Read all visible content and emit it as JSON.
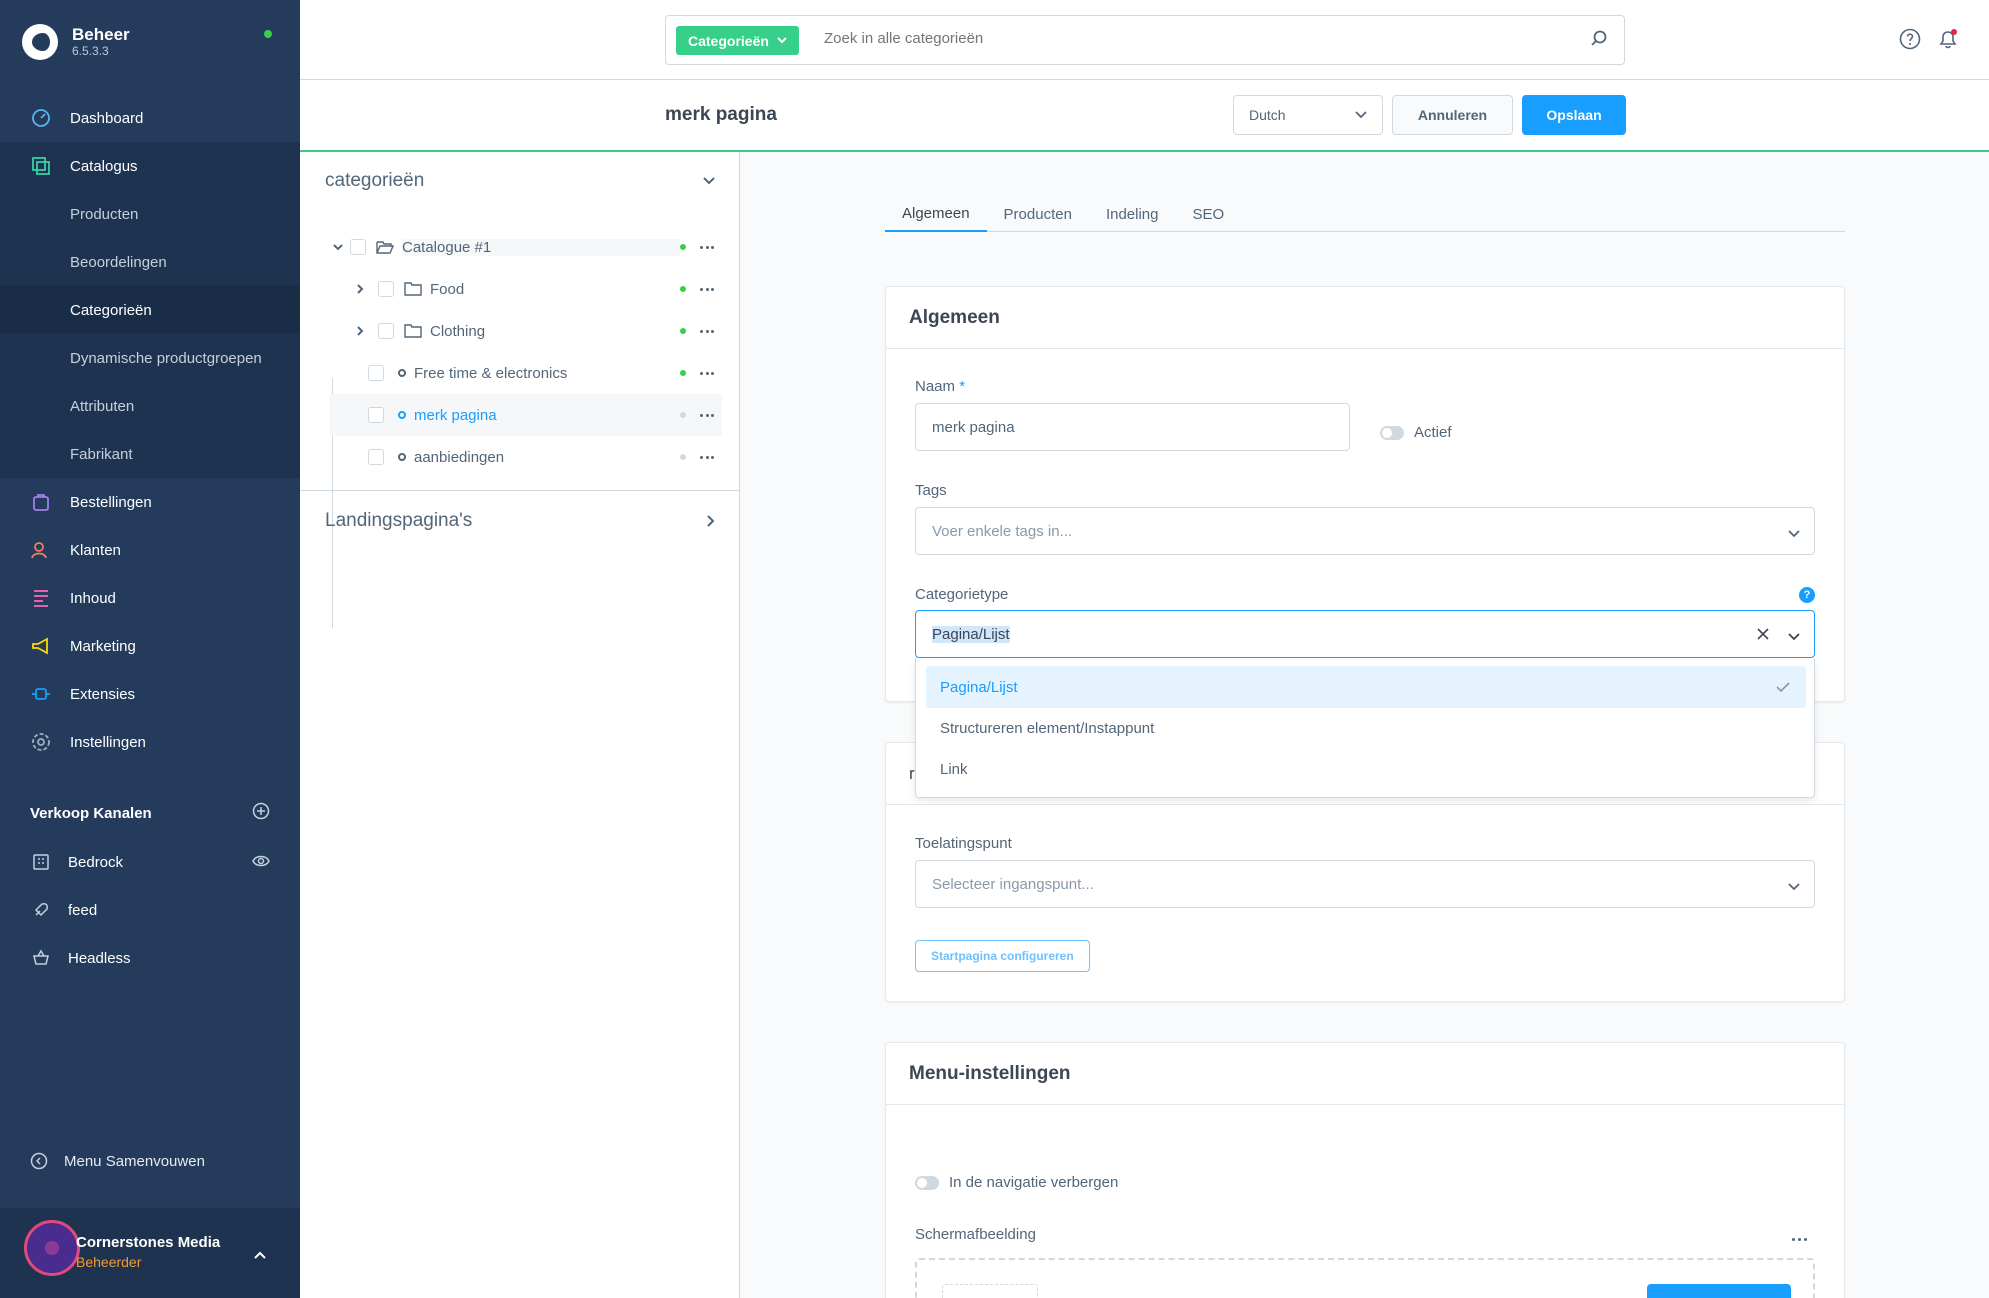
{
  "app": {
    "name": "Beheer",
    "version": "6.5.3.3"
  },
  "sidebar": {
    "items": [
      {
        "label": "Dashboard",
        "icon": "dashboard-icon"
      },
      {
        "label": "Catalogus",
        "icon": "catalog-icon"
      },
      {
        "label": "Bestellingen",
        "icon": "orders-icon"
      },
      {
        "label": "Klanten",
        "icon": "customers-icon"
      },
      {
        "label": "Inhoud",
        "icon": "content-icon"
      },
      {
        "label": "Marketing",
        "icon": "marketing-icon"
      },
      {
        "label": "Extensies",
        "icon": "extensions-icon"
      },
      {
        "label": "Instellingen",
        "icon": "settings-icon"
      }
    ],
    "catalog_sub": [
      "Producten",
      "Beoordelingen",
      "Categorieën",
      "Dynamische productgroepen",
      "Attributen",
      "Fabrikant"
    ],
    "sales_channels_title": "Verkoop Kanalen",
    "sales_channels": [
      "Bedrock",
      "feed",
      "Headless"
    ],
    "collapse_label": "Menu Samenvouwen",
    "user": {
      "name": "Cornerstones Media",
      "role": "Beheerder"
    }
  },
  "search": {
    "type": "Categorieën",
    "placeholder": "Zoek in alle categorieën"
  },
  "actionbar": {
    "title": "merk pagina",
    "language": "Dutch",
    "cancel": "Annuleren",
    "save": "Opslaan"
  },
  "tree": {
    "title": "categorieën",
    "rows": [
      {
        "label": "Catalogue #1",
        "status": "active"
      },
      {
        "label": "Food",
        "status": "active"
      },
      {
        "label": "Clothing",
        "status": "active"
      },
      {
        "label": "Free time & electronics",
        "status": "active"
      },
      {
        "label": "merk pagina",
        "status": "inactive"
      },
      {
        "label": "aanbiedingen",
        "status": "inactive"
      }
    ],
    "landing": "Landingspagina's"
  },
  "tabs": [
    "Algemeen",
    "Producten",
    "Indeling",
    "SEO"
  ],
  "general": {
    "title": "Algemeen",
    "name_label": "Naam",
    "required_mark": "*",
    "name_value": "merk pagina",
    "active_label": "Actief",
    "tags_label": "Tags",
    "tags_placeholder": "Voer enkele tags in...",
    "type_label": "Categorietype",
    "type_value": "Pagina/Lijst",
    "options": [
      "Pagina/Lijst",
      "Structureren element/Instappunt",
      "Link"
    ]
  },
  "entry": {
    "partial_title": "r",
    "label": "Toelatingspunt",
    "placeholder": "Selecteer ingangspunt...",
    "button": "Startpagina configureren"
  },
  "menu": {
    "title": "Menu-instellingen",
    "hide_label": "In de navigatie verbergen",
    "image_label": "Schermafbeelding"
  },
  "colors": {
    "sidebar": "#243b5c",
    "accent": "#189eff",
    "success": "#37d08a"
  }
}
